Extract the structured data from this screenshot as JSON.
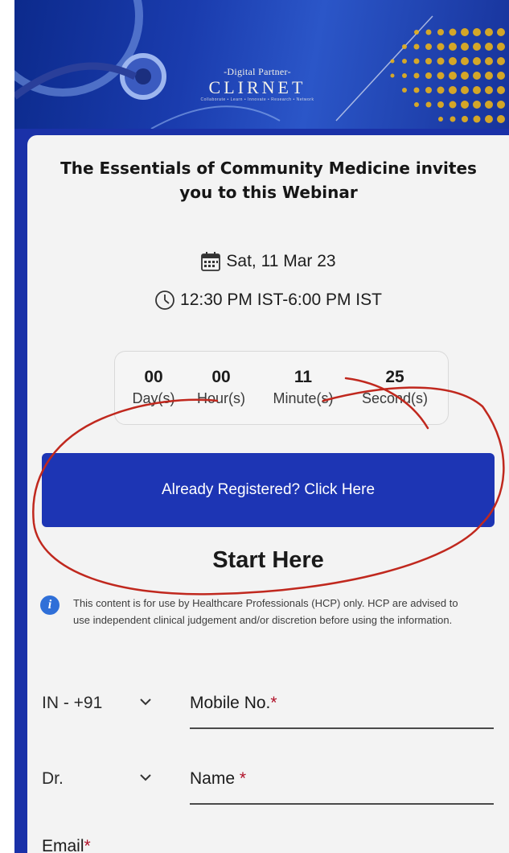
{
  "banner": {
    "partner_label": "-Digital Partner-",
    "brand_name": "CLIRNET",
    "brand_tagline": "Collaborate • Learn • Innovate • Research • Network"
  },
  "webinar": {
    "title": "The Essentials of Community Medicine invites you to this Webinar",
    "date": "Sat, 11 Mar 23",
    "time": "12:30 PM IST-6:00 PM IST"
  },
  "countdown": {
    "days": {
      "value": "00",
      "label": "Day(s)"
    },
    "hours": {
      "value": "00",
      "label": "Hour(s)"
    },
    "minutes": {
      "value": "11",
      "label": "Minute(s)"
    },
    "seconds": {
      "value": "25",
      "label": "Second(s)"
    }
  },
  "registered_button_label": "Already Registered? Click Here",
  "start_heading": "Start Here",
  "disclaimer": "This content is for use by Healthcare Professionals (HCP) only. HCP are advised to use independent clinical judgement and/or discretion before using the information.",
  "form": {
    "country_code": "IN - +91",
    "mobile_label": "Mobile No.",
    "title_prefix": "Dr.",
    "name_label": "Name",
    "email_label": "Email",
    "required_mark": "*"
  },
  "colors": {
    "brand_blue": "#1d35b4",
    "annotation_red": "#c0281e"
  },
  "icons": {
    "date": "calendar-icon",
    "time": "clock-icon",
    "info": "info-icon",
    "dropdown": "chevron-down-icon"
  }
}
